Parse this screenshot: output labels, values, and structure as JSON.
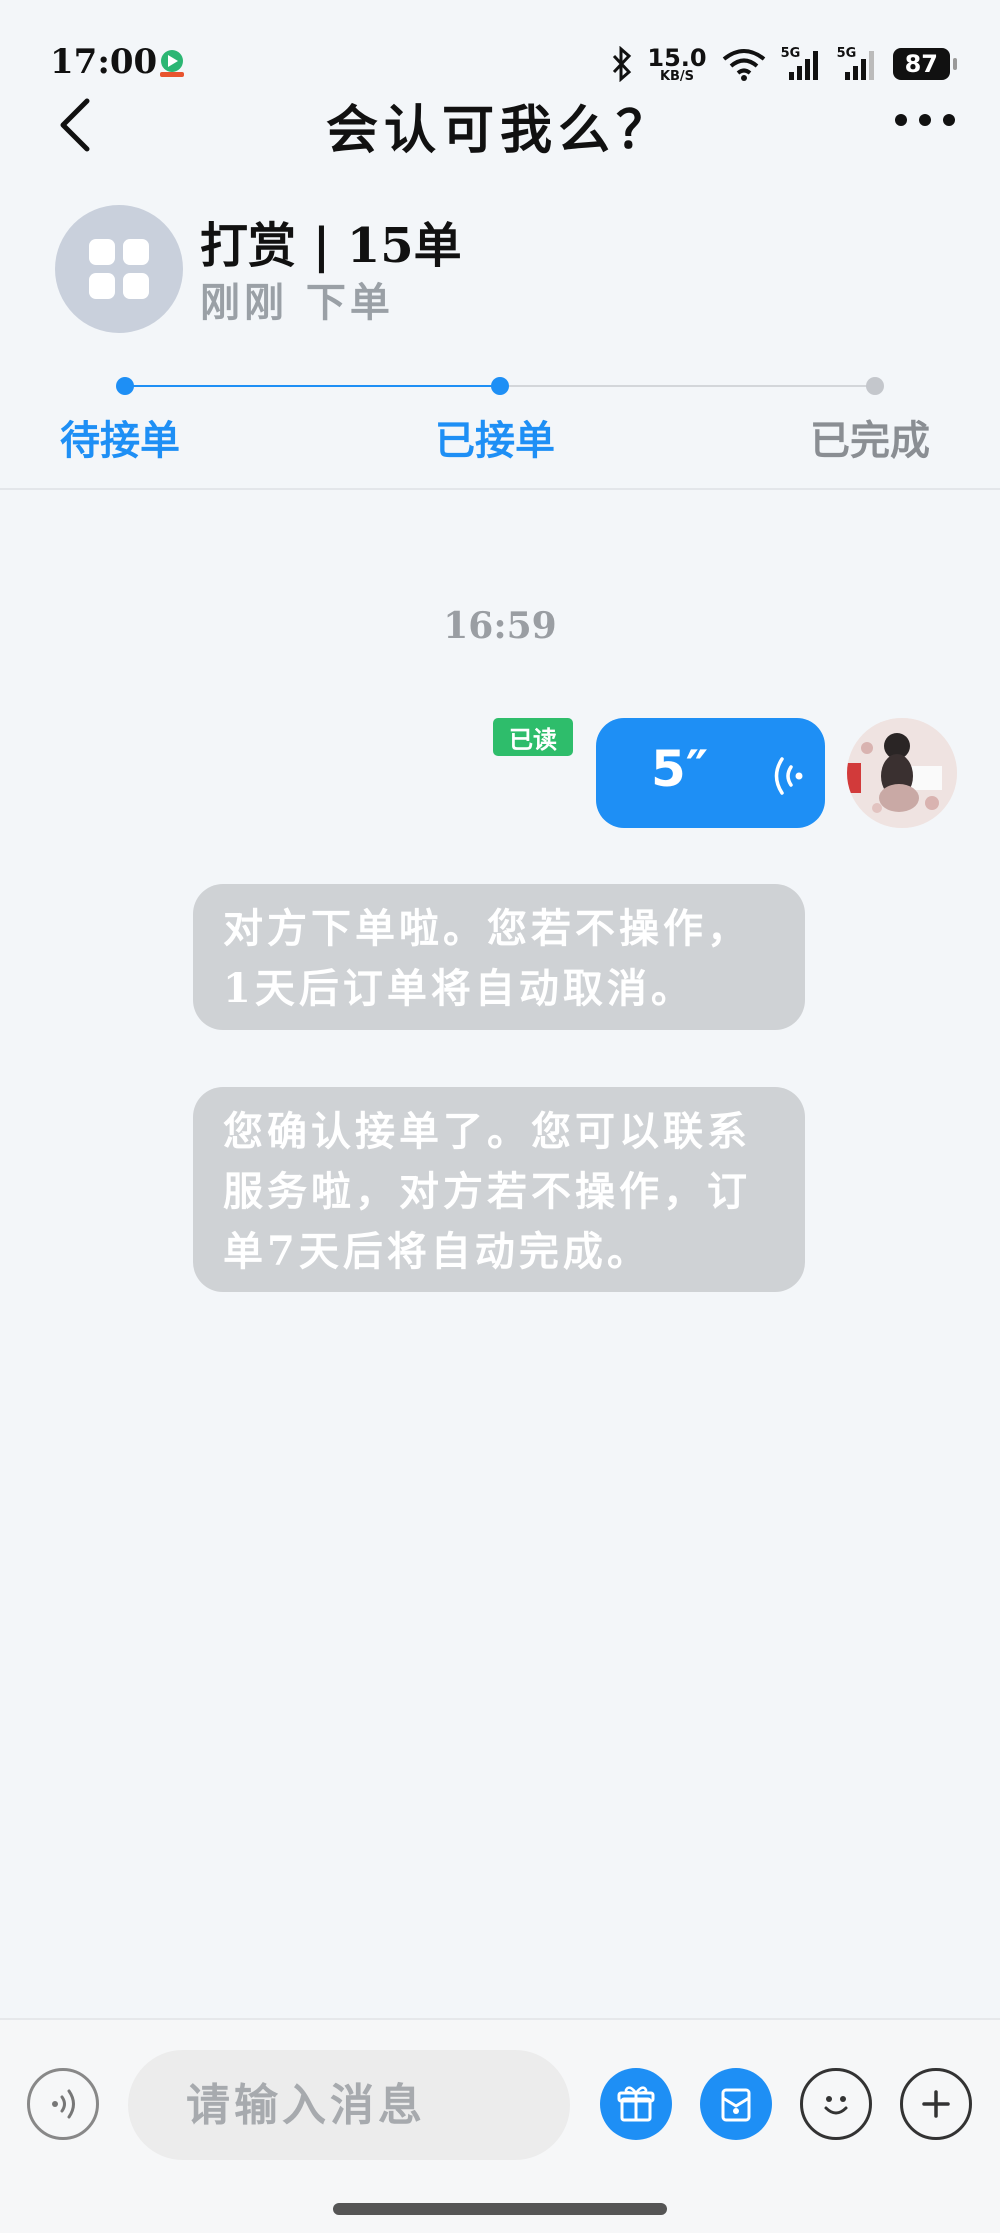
{
  "status_bar": {
    "time": "17:00",
    "net_speed_value": "15.0",
    "net_speed_unit": "KB/S",
    "signal1": "5G",
    "signal2": "5G",
    "battery": "87"
  },
  "header": {
    "title": "会认可我么？"
  },
  "order": {
    "title": "打赏 | 15单",
    "subtitle": "刚刚 下单",
    "app_icon": "app-grid-icon"
  },
  "progress": {
    "steps": [
      {
        "label": "待接单",
        "state": "done"
      },
      {
        "label": "已接单",
        "state": "current"
      },
      {
        "label": "已完成",
        "state": "pending"
      }
    ],
    "active_color": "#1e8ff5",
    "inactive_color": "#b8bcc2"
  },
  "chat": {
    "timestamp": "16:59",
    "read_badge": "已读",
    "voice_duration": "5″",
    "system_messages": [
      {
        "lines": [
          "对方下单啦。您若不操作，",
          "1天后订单将自动取消。"
        ]
      },
      {
        "lines": [
          "您确认接单了。您可以联系",
          "服务啦，对方若不操作，订",
          "单7天后将自动完成。"
        ]
      }
    ]
  },
  "composer": {
    "placeholder": "请输入消息",
    "icons": [
      "voice-icon",
      "gift-icon",
      "coupon-icon",
      "emoji-icon",
      "plus-icon"
    ],
    "accent": "#1e8ff5"
  }
}
